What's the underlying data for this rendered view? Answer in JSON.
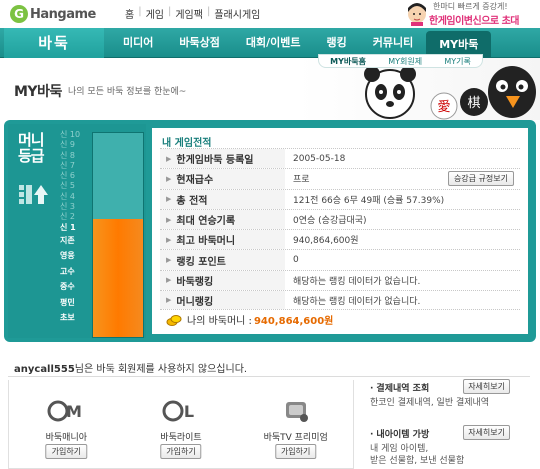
{
  "topbar": {
    "logo_text": "Hangame",
    "nav": [
      "홈",
      "게임",
      "게임팩",
      "플래시게임"
    ],
    "promo_small": "한마디 빠르게 증강게!",
    "promo_big": "한게임이변신으로 초대"
  },
  "mainnav": {
    "brand": "바둑",
    "items": [
      "미디어",
      "바둑상점",
      "대회/이벤트",
      "랭킹",
      "커뮤니티",
      "MY바둑"
    ],
    "active_index": 5
  },
  "subnav": {
    "items": [
      "MY바둑홈",
      "MY회원제",
      "MY기록"
    ],
    "active_index": 0
  },
  "header": {
    "title": "MY바둑",
    "desc": "나의 모든 바둑 정보를 한눈에~"
  },
  "grade": {
    "title_line1": "머니",
    "title_line2": "등급",
    "levels": [
      "신 10",
      "신 9",
      "신 8",
      "신 7",
      "신 6",
      "신 5",
      "신 4",
      "신 3",
      "신 2",
      "신 1"
    ],
    "lower_levels": [
      "지존",
      "영웅",
      "고수",
      "중수",
      "평민",
      "초보"
    ],
    "current": "신 1",
    "fill_fraction": 0.58
  },
  "record": {
    "title": "내 게임전적",
    "rows": [
      {
        "label": "한게임바둑 등록일",
        "value": "2005-05-18",
        "button": ""
      },
      {
        "label": "현재급수",
        "value": "프로",
        "button": "승강급 규정보기"
      },
      {
        "label": "총 전적",
        "value": "121전 66승 6무 49패 (승률 57.39%)",
        "button": ""
      },
      {
        "label": "최대 연승기록",
        "value": "0연승 (승강급대국)",
        "button": ""
      },
      {
        "label": "최고 바둑머니",
        "value": "940,864,600원",
        "button": ""
      },
      {
        "label": "랭킹 포인트",
        "value": "0",
        "button": ""
      },
      {
        "label": "바둑랭킹",
        "value": "해당하는 랭킹 데이터가 없습니다.",
        "button": ""
      },
      {
        "label": "머니랭킹",
        "value": "해당하는 랭킹 데이터가 없습니다.",
        "button": ""
      }
    ],
    "money_label": "나의 바둑머니 :",
    "money_value": "940,864,600원"
  },
  "bottom": {
    "user": "anycall555",
    "message": "님은 바둑 회원제를 사용하지 않으십니다.",
    "products": [
      {
        "name": "바둑매니아",
        "button": "가입하기",
        "icon": "badukmania-icon"
      },
      {
        "name": "바둑라이트",
        "button": "가입하기",
        "icon": "baduklight-icon"
      },
      {
        "name": "바둑TV 프리미엄",
        "button": "가입하기",
        "icon": "baduktv-icon"
      }
    ],
    "links": [
      {
        "title": "결제내역 조회",
        "button": "자세히보기",
        "desc": "한코인 결제내역, 일반 결제내역"
      },
      {
        "title": "내아이템 가방",
        "button": "자세히보기",
        "desc": "내 게임 아이템,\n받은 선물함, 보낸 선물함"
      }
    ]
  },
  "colors": {
    "teal": "#1f9a97",
    "orange": "#f7941d",
    "pink": "#e0327a"
  }
}
